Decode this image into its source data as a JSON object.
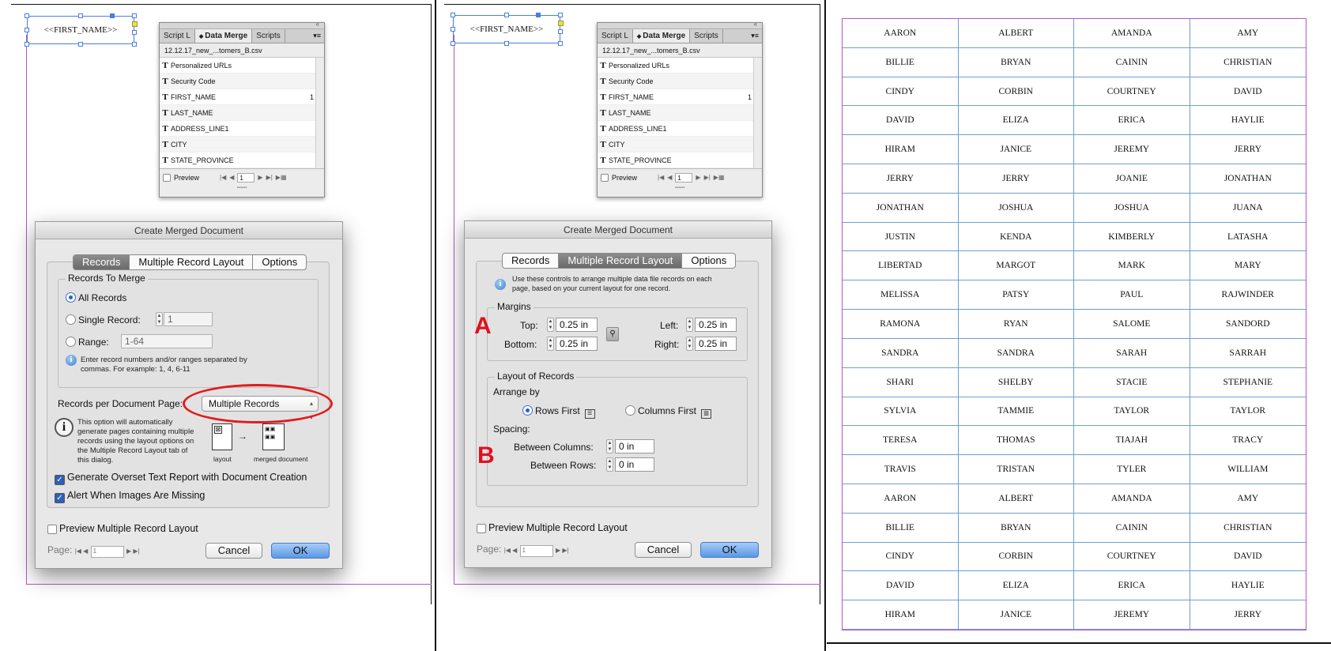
{
  "left_panel": {
    "frame_text": "<<FIRST_NAME>>",
    "data_merge": {
      "tabs": [
        "Script L",
        "Data Merge",
        "Scripts"
      ],
      "file": "12.12.17_new_...tomers_B.csv",
      "fields": [
        {
          "name": "Personalized URLs",
          "count": ""
        },
        {
          "name": "Security Code",
          "count": ""
        },
        {
          "name": "FIRST_NAME",
          "count": "1"
        },
        {
          "name": "LAST_NAME",
          "count": ""
        },
        {
          "name": "ADDRESS_LINE1",
          "count": ""
        },
        {
          "name": "CITY",
          "count": ""
        },
        {
          "name": "STATE_PROVINCE",
          "count": ""
        }
      ],
      "preview_label": "Preview",
      "page_value": "1"
    },
    "dialog": {
      "title": "Create Merged Document",
      "tabs": [
        "Records",
        "Multiple Record Layout",
        "Options"
      ],
      "records_to_merge": "Records To Merge",
      "all_records": "All Records",
      "single_record": "Single Record:",
      "single_value": "1",
      "range": "Range:",
      "range_value": "1-64",
      "range_hint": [
        "Enter record numbers and/or ranges separated by",
        "commas. For example: 1, 4, 6-11"
      ],
      "records_per_page_label": "Records per Document Page:",
      "records_per_page_value": "Multiple Records",
      "option_note": [
        "This option will automatically",
        "generate pages containing multiple",
        "records using the layout options on",
        "the Multiple Record Layout tab of",
        "this dialog."
      ],
      "layout_caption": "layout",
      "merged_caption": "merged document",
      "overset_label": "Generate Overset Text Report with Document Creation",
      "alert_label": "Alert When Images Are Missing",
      "preview_layout_label": "Preview Multiple Record Layout",
      "page_label": "Page:",
      "page_value": "1",
      "cancel": "Cancel",
      "ok": "OK"
    }
  },
  "middle_panel": {
    "frame_text": "<<FIRST_NAME>>",
    "data_merge": {
      "tabs": [
        "Script L",
        "Data Merge",
        "Scripts"
      ],
      "file": "12.12.17_new_...tomers_B.csv",
      "fields": [
        {
          "name": "Personalized URLs",
          "count": ""
        },
        {
          "name": "Security Code",
          "count": ""
        },
        {
          "name": "FIRST_NAME",
          "count": "1"
        },
        {
          "name": "LAST_NAME",
          "count": ""
        },
        {
          "name": "ADDRESS_LINE1",
          "count": ""
        },
        {
          "name": "CITY",
          "count": ""
        },
        {
          "name": "STATE_PROVINCE",
          "count": ""
        }
      ],
      "preview_label": "Preview",
      "page_value": "1"
    },
    "dialog": {
      "title": "Create Merged Document",
      "tabs": [
        "Records",
        "Multiple Record Layout",
        "Options"
      ],
      "intro": [
        "Use these controls to arrange multiple data file records on each",
        "page, based on your current layout for one record."
      ],
      "margins": "Margins",
      "top": "Top:",
      "top_value": "0.25 in",
      "bottom": "Bottom:",
      "bottom_value": "0.25 in",
      "left": "Left:",
      "left_value": "0.25 in",
      "right": "Right:",
      "right_value": "0.25 in",
      "layout_of_records": "Layout of Records",
      "arrange_by": "Arrange by",
      "rows_first": "Rows First",
      "columns_first": "Columns First",
      "spacing": "Spacing:",
      "between_columns": "Between Columns:",
      "between_columns_value": "0 in",
      "between_rows": "Between Rows:",
      "between_rows_value": "0 in",
      "marker_a": "A",
      "marker_b": "B",
      "preview_layout_label": "Preview Multiple Record Layout",
      "page_label": "Page:",
      "page_value": "1",
      "cancel": "Cancel",
      "ok": "OK"
    }
  },
  "right_panel": {
    "names": [
      "AARON",
      "ALBERT",
      "AMANDA",
      "AMY",
      "BILLIE",
      "BRYAN",
      "CAININ",
      "CHRISTIAN",
      "CINDY",
      "CORBIN",
      "COURTNEY",
      "DAVID",
      "DAVID",
      "ELIZA",
      "ERICA",
      "HAYLIE",
      "HIRAM",
      "JANICE",
      "JEREMY",
      "JERRY",
      "JERRY",
      "JERRY",
      "JOANIE",
      "JONATHAN",
      "JONATHAN",
      "JOSHUA",
      "JOSHUA",
      "JUANA",
      "JUSTIN",
      "KENDA",
      "KIMBERLY",
      "LATASHA",
      "LIBERTAD",
      "MARGOT",
      "MARK",
      "MARY",
      "MELISSA",
      "PATSY",
      "PAUL",
      "RAJWINDER",
      "RAMONA",
      "RYAN",
      "SALOME",
      "SANDORD",
      "SANDRA",
      "SANDRA",
      "SARAH",
      "SARRAH",
      "SHARI",
      "SHELBY",
      "STACIE",
      "STEPHANIE",
      "SYLVIA",
      "TAMMIE",
      "TAYLOR",
      "TAYLOR",
      "TERESA",
      "THOMAS",
      "TIAJAH",
      "TRACY",
      "TRAVIS",
      "TRISTAN",
      "TYLER",
      "WILLIAM",
      "AARON",
      "ALBERT",
      "AMANDA",
      "AMY",
      "BILLIE",
      "BRYAN",
      "CAININ",
      "CHRISTIAN",
      "CINDY",
      "CORBIN",
      "COURTNEY",
      "DAVID",
      "DAVID",
      "ELIZA",
      "ERICA",
      "HAYLIE",
      "HIRAM",
      "JANICE",
      "JEREMY",
      "JERRY"
    ]
  },
  "colors": {
    "highlight_ring": "#e01c1c",
    "margin_guide": "#b455c9",
    "frame_guide": "#4a7ee0",
    "grid_line": "#6d9fd0"
  }
}
